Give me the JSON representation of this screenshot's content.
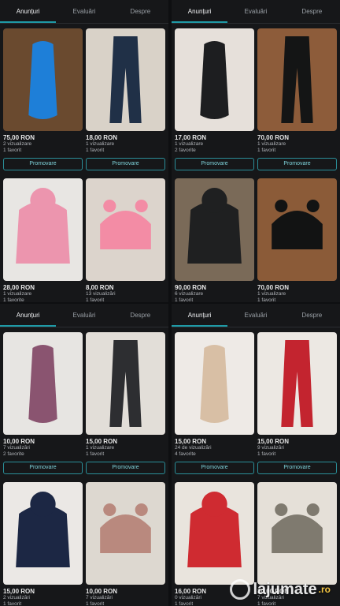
{
  "tabs": [
    "Anunțuri",
    "Evaluări",
    "Despre"
  ],
  "panels": [
    {
      "cards": [
        {
          "price": "75,00 RON",
          "meta1": "2 vizualizare",
          "meta2": "1 favorit",
          "button": "Promovare",
          "color": "#1e7fd8",
          "bg": "#6a4a2f"
        },
        {
          "price": "18,00 RON",
          "meta1": "1 vizualizare",
          "meta2": "1 favorit",
          "button": "Promovare",
          "color": "#203047",
          "bg": "#d9d2c8"
        },
        {
          "price": "28,00 RON",
          "meta1": "1 vizualizare",
          "meta2": "1 favorite",
          "button": "",
          "color": "#ec95ae",
          "bg": "#e8e6e3"
        },
        {
          "price": "8,00 RON",
          "meta1": "13 vizualizări",
          "meta2": "1 favorit",
          "button": "",
          "color": "#f38ca5",
          "bg": "#dcd4cc"
        }
      ]
    },
    {
      "cards": [
        {
          "price": "17,00 RON",
          "meta1": "1 vizualizare",
          "meta2": "2 favorite",
          "button": "Promovare",
          "color": "#1d1e20",
          "bg": "#e6e0da"
        },
        {
          "price": "70,00 RON",
          "meta1": "1 vizualizare",
          "meta2": "1 favorit",
          "button": "Promovare",
          "color": "#141515",
          "bg": "#8d5c3a"
        },
        {
          "price": "90,00 RON",
          "meta1": "6 vizualizare",
          "meta2": "1 favorit",
          "button": "",
          "color": "#1f2021",
          "bg": "#7a6a58"
        },
        {
          "price": "70,00 RON",
          "meta1": "1 vizualizare",
          "meta2": "1 favorit",
          "button": "",
          "color": "#121313",
          "bg": "#8b5b38"
        }
      ]
    },
    {
      "cards": [
        {
          "price": "10,00 RON",
          "meta1": "7 vizualizări",
          "meta2": "2 favorite",
          "button": "Promovare",
          "color": "#8a5470",
          "bg": "#e7e5e2"
        },
        {
          "price": "15,00 RON",
          "meta1": "1 vizualizare",
          "meta2": "1 favorit",
          "button": "Promovare",
          "color": "#2d2e31",
          "bg": "#e2ded8"
        },
        {
          "price": "15,00 RON",
          "meta1": "2 vizualizări",
          "meta2": "1 favorit",
          "button": "",
          "color": "#1c2744",
          "bg": "#ebe8e5"
        },
        {
          "price": "10,00 RON",
          "meta1": "7 vizualizări",
          "meta2": "1 favorit",
          "button": "",
          "color": "#b9897e",
          "bg": "#ddd8d0"
        }
      ]
    },
    {
      "cards": [
        {
          "price": "15,00 RON",
          "meta1": "24 de vizualizări",
          "meta2": "4 favorite",
          "button": "Promovare",
          "color": "#d8bfa5",
          "bg": "#eeeae6"
        },
        {
          "price": "15,00 RON",
          "meta1": "9 vizualizări",
          "meta2": "1 favorit",
          "button": "Promovare",
          "color": "#c3242f",
          "bg": "#ece8e3"
        },
        {
          "price": "16,00 RON",
          "meta1": "0 vizualizări",
          "meta2": "1 favorit",
          "button": "",
          "color": "#cf2b31",
          "bg": "#e9e4dd"
        },
        {
          "price": "10,00 RON",
          "meta1": "7 vizualizări",
          "meta2": "1 favorit",
          "button": "",
          "color": "#7f7a6f",
          "bg": "#e5e0d8"
        }
      ]
    }
  ],
  "watermark": "lajumate",
  "watermark_dot": ".ro"
}
